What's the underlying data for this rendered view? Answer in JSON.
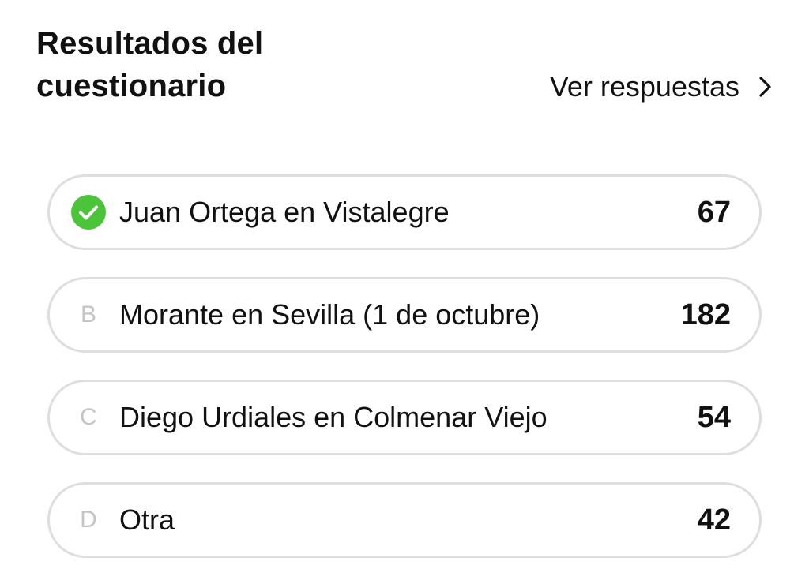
{
  "header": {
    "title": "Resultados del cuestionario",
    "view_answers_label": "Ver respuestas",
    "view_answers_icon": "chevron-right-icon"
  },
  "options": [
    {
      "marker": "",
      "marker_icon": "check-circle-icon",
      "label": "Juan Ortega en Vistalegre",
      "count": "67",
      "correct": true
    },
    {
      "marker": "B",
      "label": "Morante en Sevilla (1 de octubre)",
      "count": "182",
      "correct": false
    },
    {
      "marker": "C",
      "label": "Diego Urdiales en Colmenar Viejo",
      "count": "54",
      "correct": false
    },
    {
      "marker": "D",
      "label": "Otra",
      "count": "42",
      "correct": false
    }
  ],
  "colors": {
    "correct_green": "#4cc43a",
    "border": "#dedede",
    "letter_gray": "#c4c4c4",
    "text": "#111111"
  }
}
